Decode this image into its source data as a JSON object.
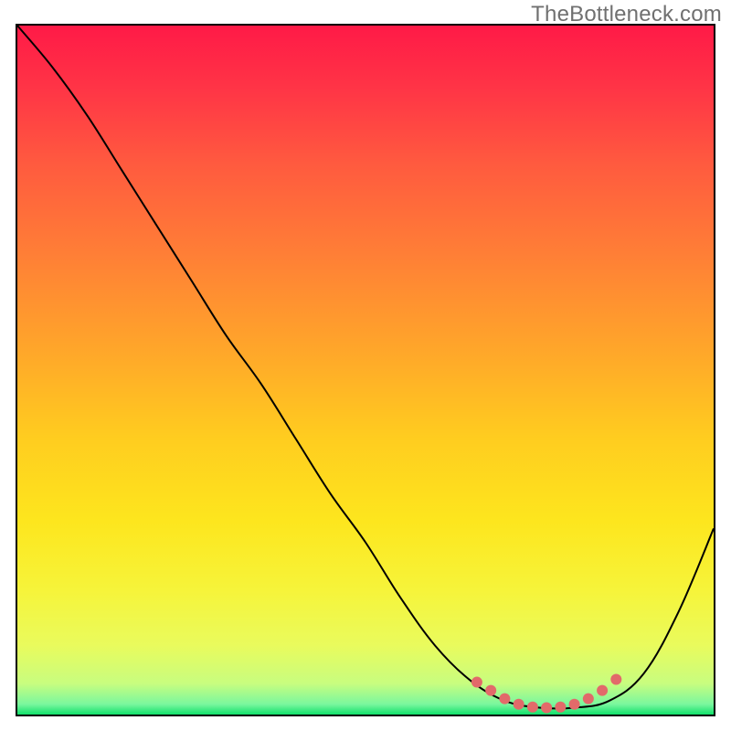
{
  "watermark": "TheBottleneck.com",
  "chart_data": {
    "type": "line",
    "title": "",
    "xlabel": "",
    "ylabel": "",
    "x": [
      0.0,
      0.05,
      0.1,
      0.15,
      0.2,
      0.25,
      0.3,
      0.35,
      0.4,
      0.45,
      0.5,
      0.55,
      0.6,
      0.65,
      0.7,
      0.75,
      0.8,
      0.85,
      0.9,
      0.95,
      1.0
    ],
    "values": [
      1.0,
      0.94,
      0.87,
      0.79,
      0.71,
      0.63,
      0.55,
      0.48,
      0.4,
      0.32,
      0.25,
      0.17,
      0.1,
      0.05,
      0.02,
      0.01,
      0.01,
      0.02,
      0.06,
      0.15,
      0.27
    ],
    "curve_main": {
      "name": "bottleneck-curve",
      "color": "#000000"
    },
    "marker_band": {
      "name": "optimal-region-markers",
      "color": "#e26a6a",
      "points": [
        {
          "x": 0.66,
          "y": 0.047
        },
        {
          "x": 0.68,
          "y": 0.035
        },
        {
          "x": 0.7,
          "y": 0.023
        },
        {
          "x": 0.72,
          "y": 0.015
        },
        {
          "x": 0.74,
          "y": 0.011
        },
        {
          "x": 0.76,
          "y": 0.01
        },
        {
          "x": 0.78,
          "y": 0.011
        },
        {
          "x": 0.8,
          "y": 0.015
        },
        {
          "x": 0.82,
          "y": 0.023
        },
        {
          "x": 0.84,
          "y": 0.035
        },
        {
          "x": 0.86,
          "y": 0.051
        }
      ]
    },
    "xlim": [
      0,
      1
    ],
    "ylim": [
      0,
      1
    ],
    "grid": false,
    "legend": false,
    "background_gradient": {
      "stops": [
        {
          "offset": 0.0,
          "color": "#ff1a47"
        },
        {
          "offset": 0.09,
          "color": "#ff3446"
        },
        {
          "offset": 0.2,
          "color": "#ff5a3f"
        },
        {
          "offset": 0.33,
          "color": "#ff7e36"
        },
        {
          "offset": 0.47,
          "color": "#ffa62a"
        },
        {
          "offset": 0.6,
          "color": "#ffcd1f"
        },
        {
          "offset": 0.72,
          "color": "#fde61e"
        },
        {
          "offset": 0.82,
          "color": "#f6f43a"
        },
        {
          "offset": 0.9,
          "color": "#e9fb5d"
        },
        {
          "offset": 0.955,
          "color": "#c8fd7f"
        },
        {
          "offset": 0.985,
          "color": "#7af79e"
        },
        {
          "offset": 1.0,
          "color": "#11e06b"
        }
      ]
    }
  }
}
